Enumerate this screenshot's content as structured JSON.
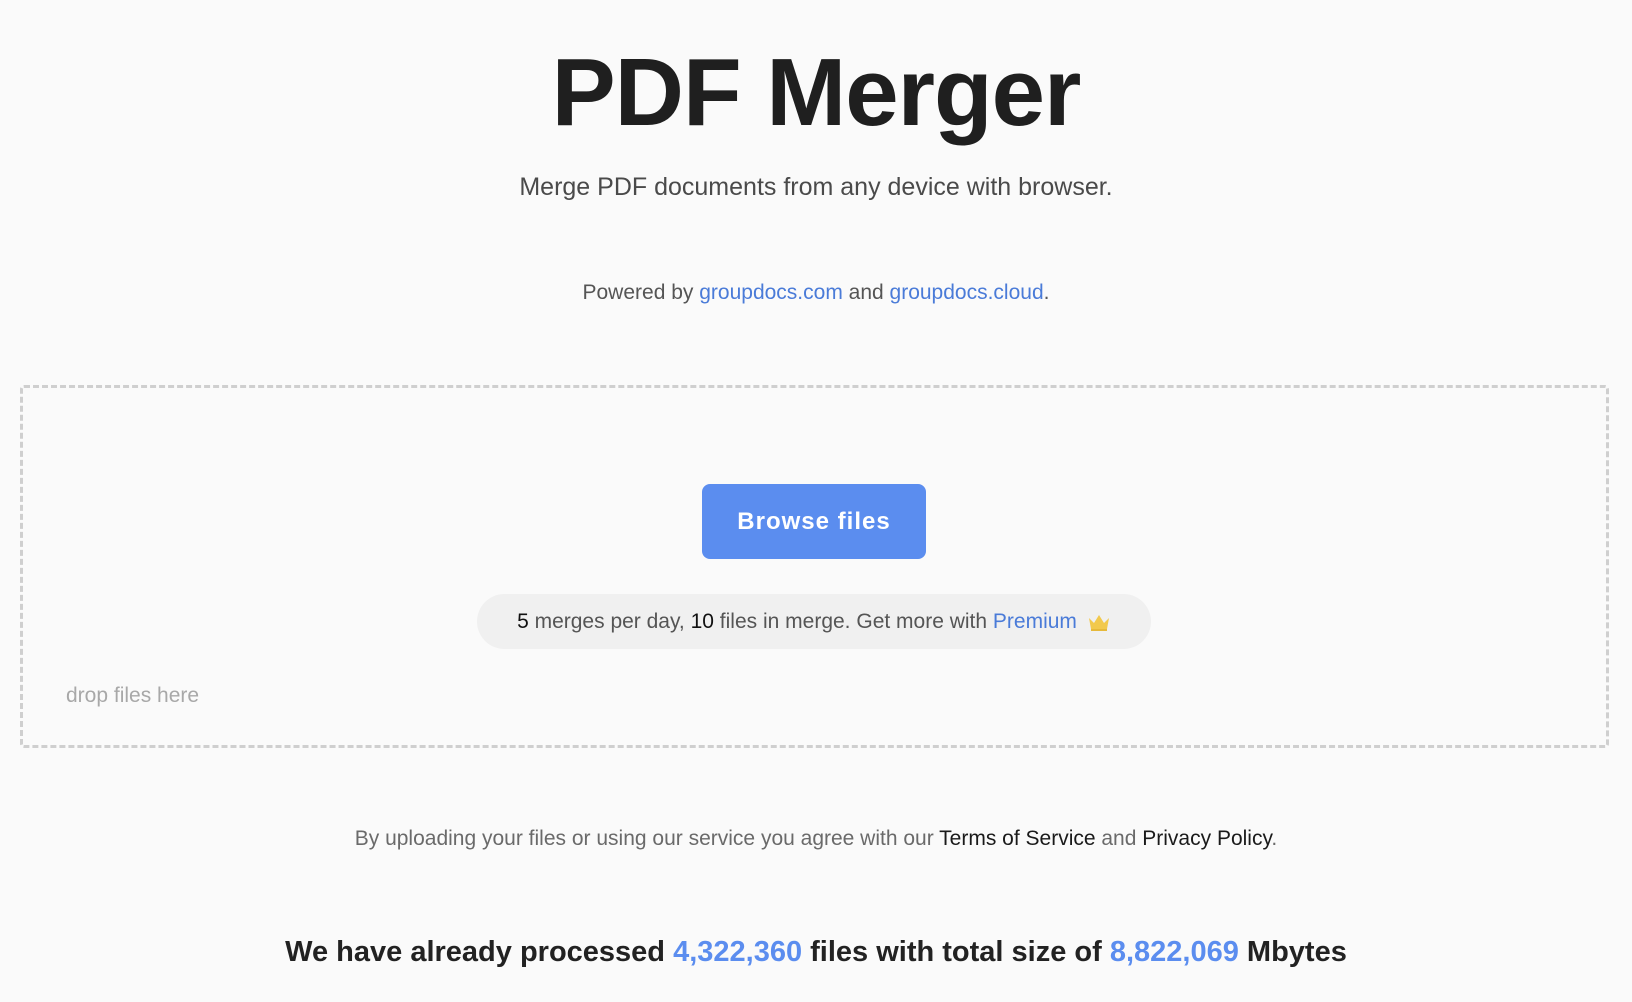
{
  "header": {
    "title": "PDF Merger",
    "subtitle": "Merge PDF documents from any device with browser."
  },
  "powered": {
    "prefix": "Powered by ",
    "link1": "groupdocs.com",
    "middle": " and ",
    "link2": "groupdocs.cloud",
    "suffix": "."
  },
  "dropzone": {
    "browse_label": "Browse files",
    "hint": "drop files here",
    "limits": {
      "merges_count": "5",
      "merges_text": " merges per day, ",
      "files_count": "10",
      "files_text": " files in merge. Get more with ",
      "premium_link": "Premium",
      "crown_icon": "crown-icon",
      "crown_color": "#f2c94c"
    }
  },
  "terms": {
    "prefix": "By uploading your files or using our service you agree with our ",
    "tos_link": "Terms of Service",
    "middle": " and ",
    "privacy_link": "Privacy Policy",
    "suffix": "."
  },
  "stats": {
    "prefix": "We have already processed ",
    "files_count": "4,322,360",
    "middle": " files with total size of ",
    "size": "8,822,069",
    "suffix": " Mbytes"
  },
  "colors": {
    "accent": "#5b8def",
    "link": "#4a7bd8",
    "background": "#fafafa"
  }
}
